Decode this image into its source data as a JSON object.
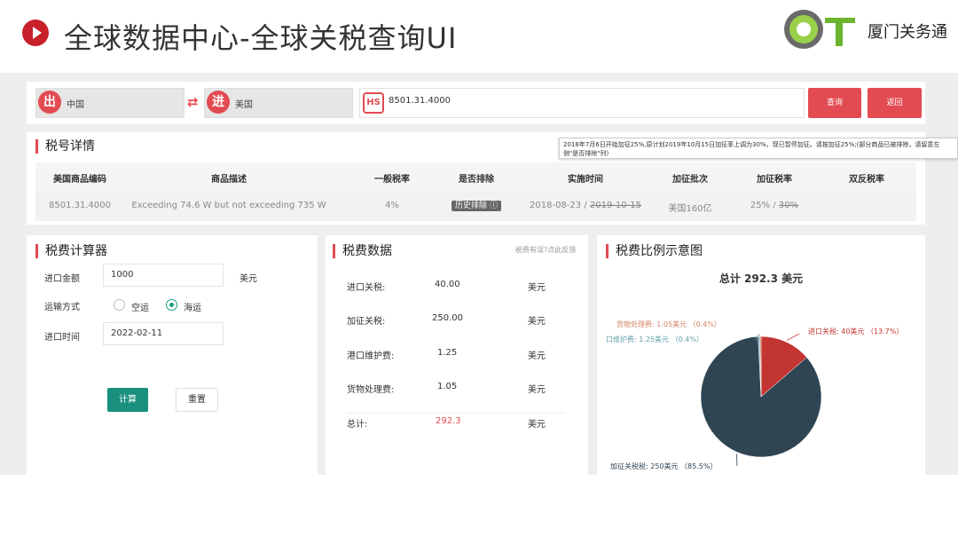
{
  "slide": {
    "title": "全球数据中心-全球关税查询UI",
    "brand": "厦门关务通"
  },
  "search": {
    "origin_badge": "出",
    "origin": "中国",
    "dest_badge": "进",
    "dest": "美国",
    "swap_symbol": "⇄",
    "hs_badge": "HS",
    "hs_code": "8501.31.4000",
    "query_label": "查询",
    "back_label": "返回"
  },
  "detail": {
    "title": "税号详情",
    "headers": [
      "美国商品编码",
      "商品描述",
      "一般税率",
      "是否排除",
      "实施时间",
      "加征批次",
      "加征税率",
      "双反税率"
    ],
    "row": {
      "code": "8501.31.4000",
      "desc": "Exceeding 74.6 W but not exceeding 735 W",
      "general_rate": "4%",
      "exclusion_tag": "历史排除",
      "date_start": "2018-08-23 / ",
      "date_end": "2019-10-15",
      "batch": "美国160亿",
      "rate_a": "25% / ",
      "rate_b": "30%",
      "anti": ""
    },
    "tooltip": "2018年7月6日开始加征25%,原计划2019年10月15日加征率上调为30%。现已暂停加征。请按加征25%;(部分商品已被排除，请留意左侧\"是否排除\"列)"
  },
  "calculator": {
    "title": "税费计算器",
    "amount_label": "进口金额",
    "amount_value": "1000",
    "amount_unit": "美元",
    "transport_label": "运输方式",
    "air_label": "空运",
    "sea_label": "海运",
    "date_label": "进口时间",
    "date_value": "2022-02-11",
    "calc_button": "计算",
    "reset_button": "重置"
  },
  "fees": {
    "title": "税费数据",
    "feedback": "税费有误?点此反馈",
    "rows": [
      {
        "label": "进口关税:",
        "value": "40.00",
        "unit": "美元"
      },
      {
        "label": "加征关税:",
        "value": "250.00",
        "unit": "美元"
      },
      {
        "label": "港口维护费:",
        "value": "1.25",
        "unit": "美元"
      },
      {
        "label": "货物处理费:",
        "value": "1.05",
        "unit": "美元"
      }
    ],
    "total": {
      "label": "总计:",
      "value": "292.3",
      "unit": "美元"
    }
  },
  "ratio": {
    "title": "税费比例示意图",
    "total_label": "总计 292.3 美元",
    "slices": [
      {
        "label": "进口关税: 40美元 （13.7%）",
        "value": 40,
        "color": "#c23531"
      },
      {
        "label": "加征关税税: 250美元 （85.5%）",
        "value": 250,
        "color": "#2f4554"
      },
      {
        "label": "口维护费: 1.25美元 （0.4%）",
        "value": 1.25,
        "color": "#61a0a8"
      },
      {
        "label": "货物处理费: 1.05美元 （0.4%）",
        "value": 1.05,
        "color": "#d48265"
      }
    ]
  }
}
